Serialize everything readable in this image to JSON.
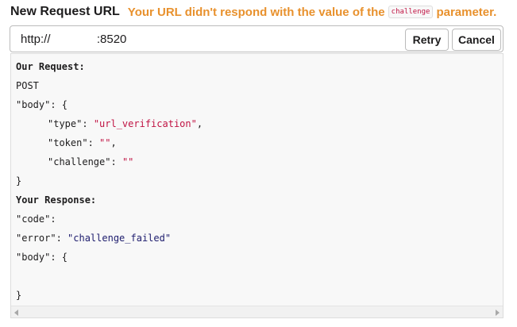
{
  "header": {
    "title": "New Request URL",
    "error_prefix": "Your URL didn't respond with the value of the",
    "error_code": "challenge",
    "error_suffix": "parameter."
  },
  "url_field": {
    "value": "http://              :8520"
  },
  "buttons": {
    "retry": "Retry",
    "cancel": "Cancel"
  },
  "request": {
    "heading": "Our Request:",
    "method": "POST",
    "body_key": "\"body\"",
    "body_open": ": {",
    "fields": [
      {
        "key": "\"type\"",
        "sep": ": ",
        "value": "\"url_verification\"",
        "end": ","
      },
      {
        "key": "\"token\"",
        "sep": ": ",
        "value": "\"\"",
        "end": ","
      },
      {
        "key": "\"challenge\"",
        "sep": ": ",
        "value": "\"\"",
        "end": ""
      }
    ],
    "body_close": "}"
  },
  "response": {
    "heading": "Your Response:",
    "code_key": "\"code\"",
    "code_sep": ":",
    "error_key": "\"error\"",
    "error_sep": ": ",
    "error_value": "\"challenge_failed\"",
    "body_key": "\"body\"",
    "body_open": ": {",
    "body_close": "}"
  },
  "colors": {
    "warning": "#e8912d",
    "string_red": "#c01343",
    "string_blue": "#1d1c6d",
    "panel_bg": "#f8f8f8"
  }
}
